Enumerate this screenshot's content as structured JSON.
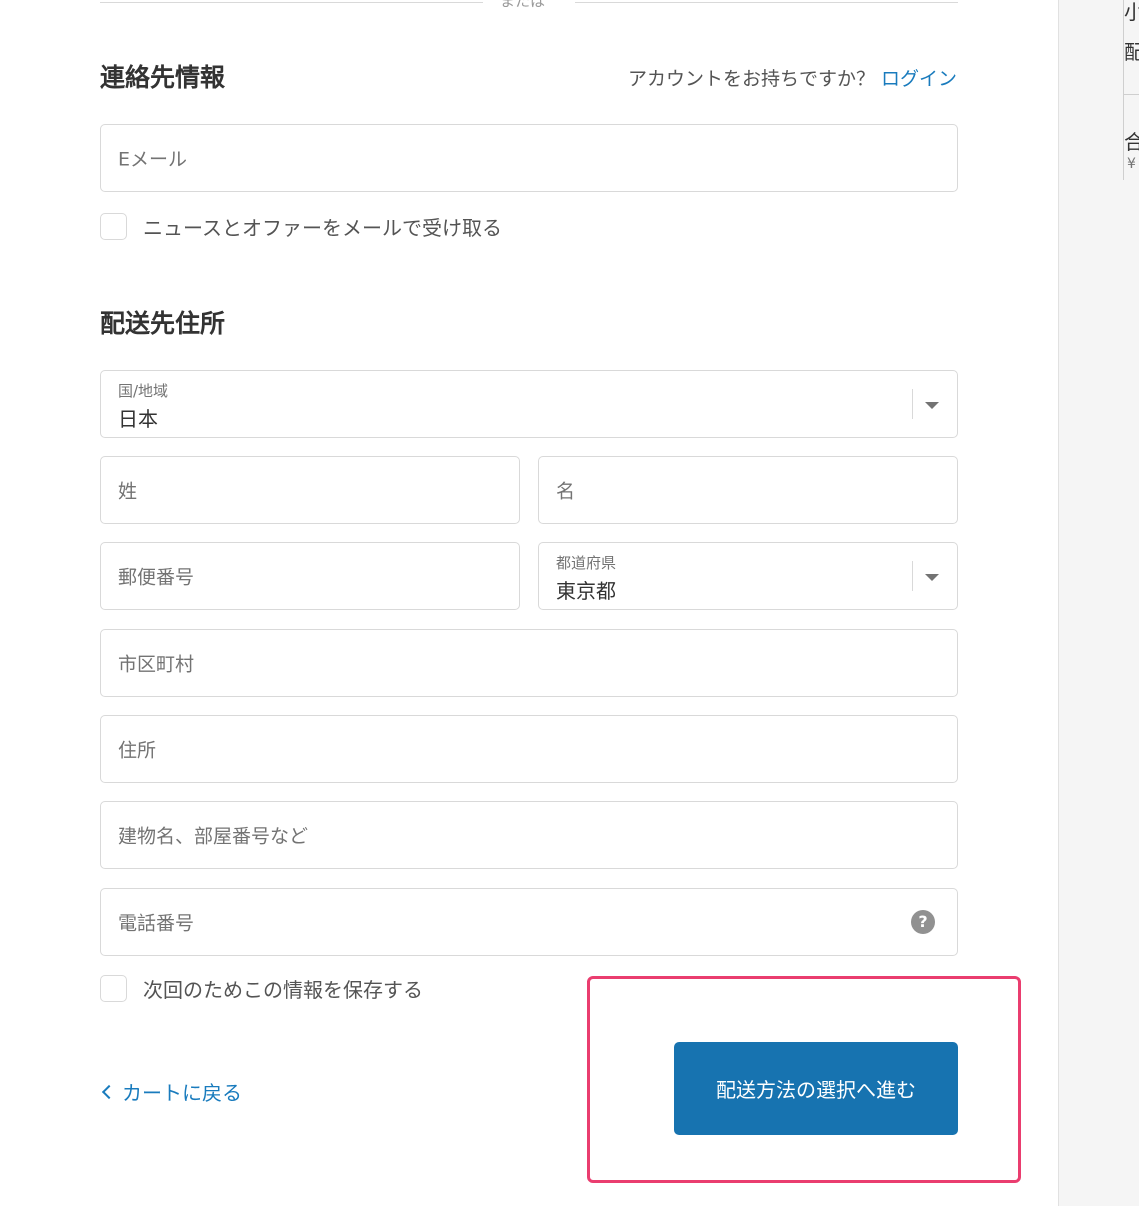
{
  "divider": {
    "text": "または"
  },
  "contact": {
    "title": "連絡先情報",
    "account_question": "アカウントをお持ちですか？",
    "login_link": "ログイン",
    "email_placeholder": "Eメール",
    "newsletter_label": "ニュースとオファーをメールで受け取る"
  },
  "shipping": {
    "title": "配送先住所",
    "country": {
      "label": "国/地域",
      "value": "日本"
    },
    "last_name_placeholder": "姓",
    "first_name_placeholder": "名",
    "postal_placeholder": "郵便番号",
    "prefecture": {
      "label": "都道府県",
      "value": "東京都"
    },
    "city_placeholder": "市区町村",
    "address_placeholder": "住所",
    "building_placeholder": "建物名、部屋番号など",
    "phone_placeholder": "電話番号",
    "help_glyph": "?",
    "save_info_label": "次回のためこの情報を保存する"
  },
  "actions": {
    "back_label": "カートに戻る",
    "continue_label": "配送方法の選択へ進む"
  },
  "sidebar": {
    "partial_1": "小",
    "partial_2": "配",
    "partial_3": "合",
    "partial_4": "¥"
  },
  "colors": {
    "accent": "#197bbd",
    "button": "#1773b0",
    "highlight": "#ea3d6f"
  }
}
